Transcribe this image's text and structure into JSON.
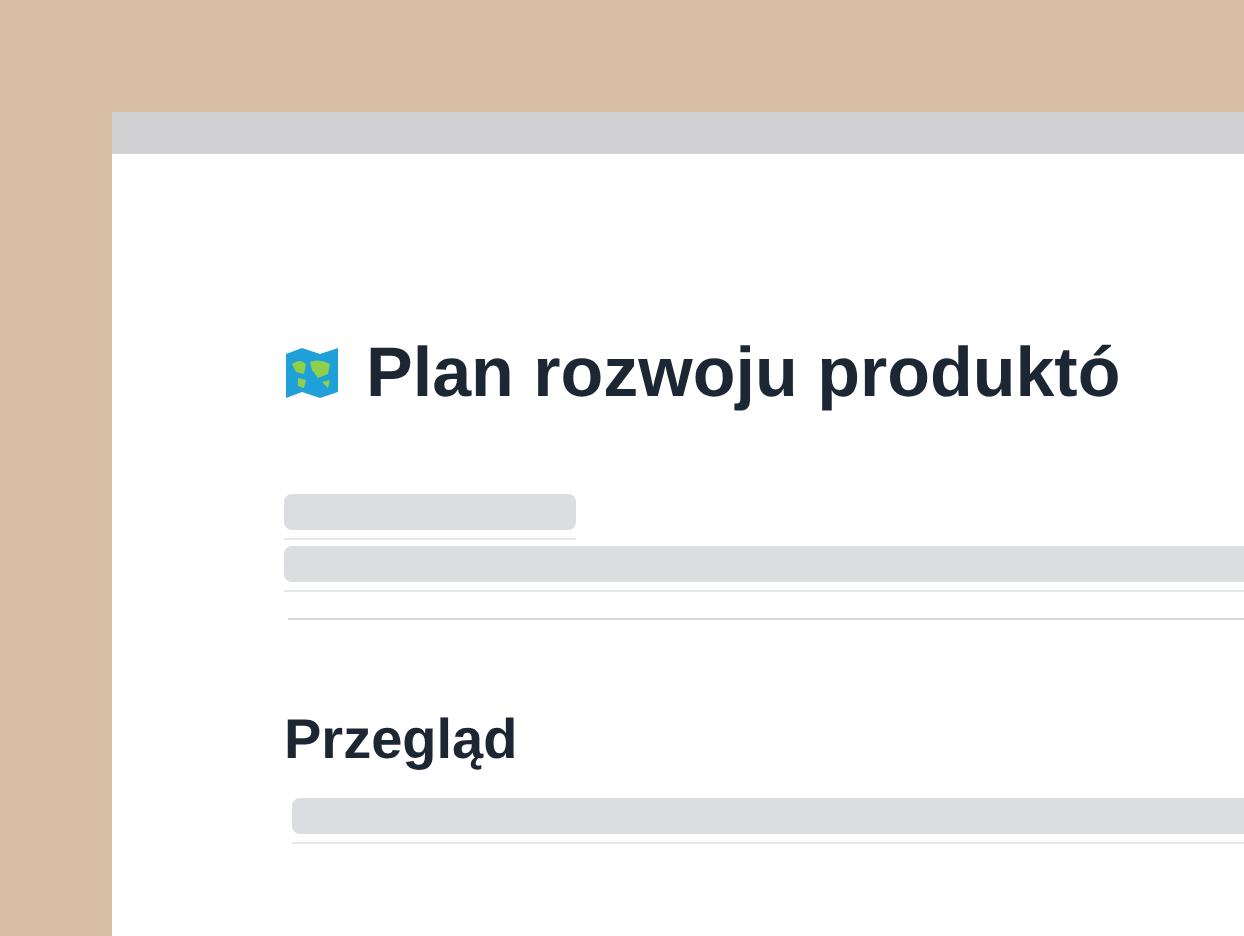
{
  "document": {
    "title": "Plan rozwoju produktó",
    "sections": [
      {
        "heading": "Przegląd"
      }
    ]
  }
}
